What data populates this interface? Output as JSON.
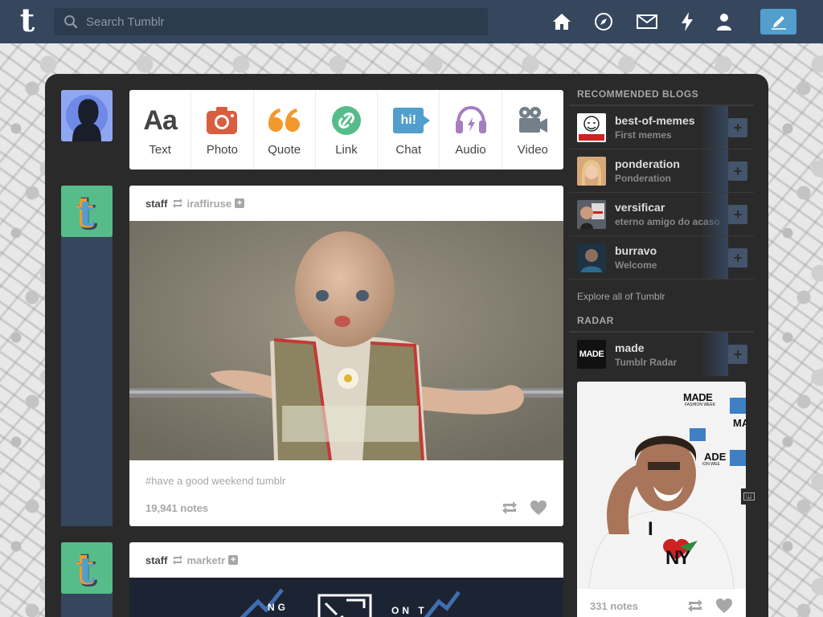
{
  "topbar": {
    "logo": "t",
    "search": {
      "placeholder": "Search Tumblr",
      "value": ""
    },
    "icons": [
      "home-icon",
      "explore-icon",
      "messages-icon",
      "activity-icon",
      "account-icon"
    ],
    "compose_icon": "pencil-icon"
  },
  "post_types": [
    {
      "label": "Text",
      "icon": "Aa"
    },
    {
      "label": "Photo",
      "icon": "camera-icon"
    },
    {
      "label": "Quote",
      "icon": "quote-icon"
    },
    {
      "label": "Link",
      "icon": "link-icon"
    },
    {
      "label": "Chat",
      "icon": "hi!"
    },
    {
      "label": "Audio",
      "icon": "headphones-icon"
    },
    {
      "label": "Video",
      "icon": "video-camera-icon"
    }
  ],
  "posts": [
    {
      "author": "staff",
      "reblogged_from": "iraffiruse",
      "tags": "#have a good weekend tumblr",
      "notes": "19,941 notes"
    },
    {
      "author": "staff",
      "reblogged_from": "marketr",
      "banner_text_left": "NG",
      "banner_text_right": "ON T"
    }
  ],
  "sidebar": {
    "recommended_title": "RECOMMENDED BLOGS",
    "blogs": [
      {
        "name": "best-of-memes",
        "title": "First memes",
        "avatar_text": "LIKE A BOSS"
      },
      {
        "name": "ponderation",
        "title": "Ponderation"
      },
      {
        "name": "versificar",
        "title": "eterno amigo do acaso"
      },
      {
        "name": "burravo",
        "title": "Welcome"
      }
    ],
    "explore_label": "Explore all of Tumblr",
    "radar_title": "RADAR",
    "radar_blog": {
      "name": "made",
      "title": "Tumblr Radar",
      "avatar_text": "MADE"
    },
    "radar_post": {
      "notes": "331 notes",
      "sign1": "MADE",
      "sign1_sub": "FASHION WEEK",
      "sign2": "MA",
      "sign3": "ADE",
      "sign3_sub": "ION WEE",
      "shirt_i": "I",
      "shirt_ny": "NY"
    }
  },
  "colors": {
    "nav": "#36465d",
    "accent": "#529ecc",
    "panel": "#2a2a2a"
  }
}
